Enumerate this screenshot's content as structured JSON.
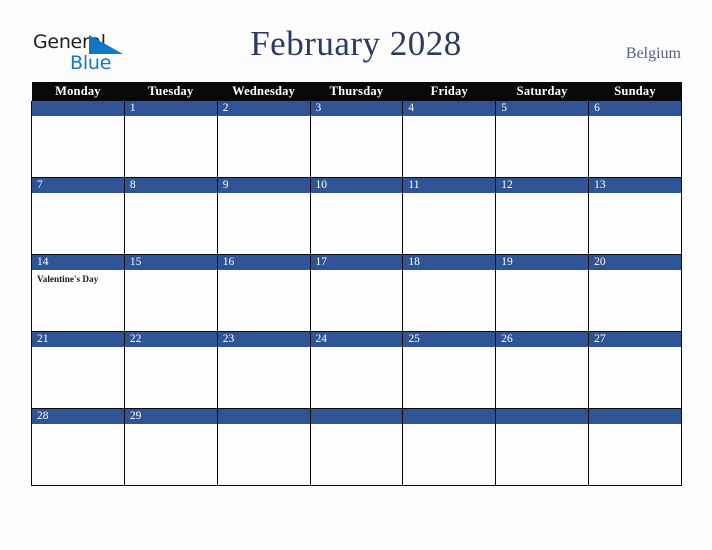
{
  "brand": {
    "line1": "General",
    "line2": "Blue",
    "line1_color": "#231f20",
    "line2_color": "#1277c4",
    "triangle_color": "#1277c4"
  },
  "header": {
    "title": "February 2028",
    "title_color": "#2b3a60",
    "region": "Belgium",
    "region_color": "#53618a"
  },
  "calendar": {
    "header_bg": "#07080a",
    "daybar_bg": "#2e5496",
    "cell_bg": "#fdfdfd",
    "grid_color": "#0a0a0a",
    "weekday_headers": [
      "Monday",
      "Tuesday",
      "Wednesday",
      "Thursday",
      "Friday",
      "Saturday",
      "Sunday"
    ],
    "weeks": [
      [
        {
          "date": "",
          "events": []
        },
        {
          "date": "1",
          "events": []
        },
        {
          "date": "2",
          "events": []
        },
        {
          "date": "3",
          "events": []
        },
        {
          "date": "4",
          "events": []
        },
        {
          "date": "5",
          "events": []
        },
        {
          "date": "6",
          "events": []
        }
      ],
      [
        {
          "date": "7",
          "events": []
        },
        {
          "date": "8",
          "events": []
        },
        {
          "date": "9",
          "events": []
        },
        {
          "date": "10",
          "events": []
        },
        {
          "date": "11",
          "events": []
        },
        {
          "date": "12",
          "events": []
        },
        {
          "date": "13",
          "events": []
        }
      ],
      [
        {
          "date": "14",
          "events": [
            "Valentine's Day"
          ]
        },
        {
          "date": "15",
          "events": []
        },
        {
          "date": "16",
          "events": []
        },
        {
          "date": "17",
          "events": []
        },
        {
          "date": "18",
          "events": []
        },
        {
          "date": "19",
          "events": []
        },
        {
          "date": "20",
          "events": []
        }
      ],
      [
        {
          "date": "21",
          "events": []
        },
        {
          "date": "22",
          "events": []
        },
        {
          "date": "23",
          "events": []
        },
        {
          "date": "24",
          "events": []
        },
        {
          "date": "25",
          "events": []
        },
        {
          "date": "26",
          "events": []
        },
        {
          "date": "27",
          "events": []
        }
      ],
      [
        {
          "date": "28",
          "events": []
        },
        {
          "date": "29",
          "events": []
        },
        {
          "date": "",
          "events": []
        },
        {
          "date": "",
          "events": []
        },
        {
          "date": "",
          "events": []
        },
        {
          "date": "",
          "events": []
        },
        {
          "date": "",
          "events": []
        }
      ]
    ]
  }
}
